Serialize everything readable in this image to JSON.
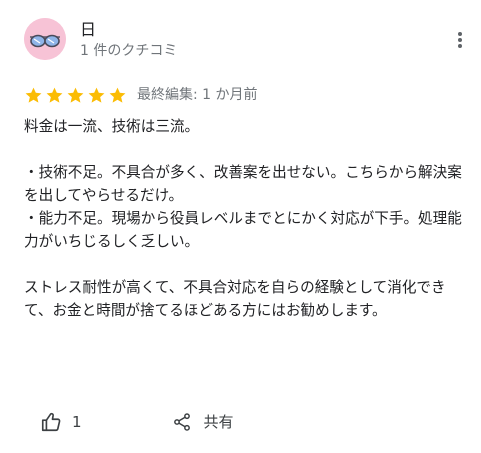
{
  "reviewer": {
    "name": "日",
    "review_count": "1 件のクチコミ",
    "avatar_icon": "sunglasses-avatar-icon"
  },
  "rating": {
    "stars": 5,
    "max": 5,
    "star_color": "#fbbc04",
    "edited": "最終編集: 1 か月前"
  },
  "review": {
    "paragraphs": [
      "料金は一流、技術は三流。",
      "・技術不足。不具合が多く、改善案を出せない。こちらから解決案を出してやらせるだけ。\n・能力不足。現場から役員レベルまでとにかく対応が下手。処理能力がいちじるしく乏しい。",
      "ストレス耐性が高くて、不具合対応を自らの経験として消化できて、お金と時間が捨てるほどある方にはお勧めします。"
    ]
  },
  "actions": {
    "like_count": "1",
    "share_label": "共有"
  }
}
